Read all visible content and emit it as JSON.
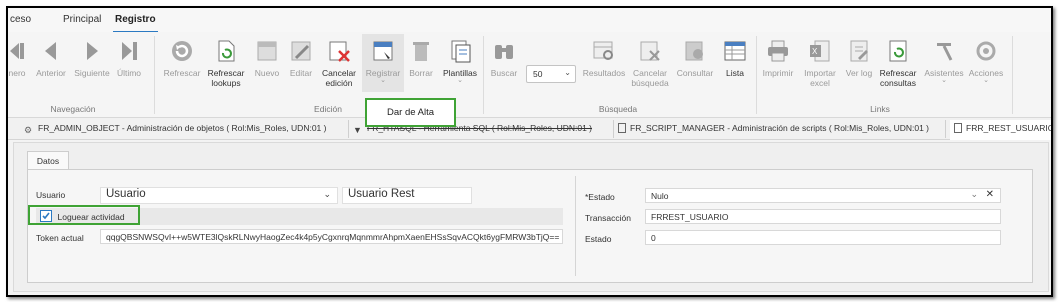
{
  "menu": {
    "tabs": [
      "ceso",
      "Principal",
      "Registro"
    ]
  },
  "ribbon": {
    "navegacion": {
      "items": [
        "nero",
        "Anterior",
        "Siguiente",
        "Último"
      ],
      "group_label": "Navegación"
    },
    "edicion": {
      "refrescar": "Refrescar",
      "refrescar_lookups_1": "Refrescar",
      "refrescar_lookups_2": "lookups",
      "nuevo": "Nuevo",
      "editar": "Editar",
      "cancelar_1": "Cancelar",
      "cancelar_2": "edición",
      "registrar": "Registrar",
      "borrar": "Borrar",
      "plantillas": "Plantillas",
      "group_label": "Edición"
    },
    "busqueda": {
      "buscar": "Buscar",
      "count_value": "50",
      "resultados": "Resultados",
      "cancelar_1": "Cancelar",
      "cancelar_2": "búsqueda",
      "consultar": "Consultar",
      "lista": "Lista",
      "group_label": "Búsqueda"
    },
    "links": {
      "imprimir": "Imprimir",
      "importar_1": "Importar",
      "importar_2": "excel",
      "ver_log": "Ver log",
      "refrescar_1": "Refrescar",
      "refrescar_2": "consultas",
      "asistentes": "Asistentes",
      "acciones": "Acciones",
      "group_label": "Links"
    }
  },
  "popup": {
    "label": "Dar de Alta"
  },
  "doc_tabs": [
    "FR_ADMIN_OBJECT - Administración de objetos ( Rol:Mis_Roles, UDN:01 )",
    "FR_HTASQL - Herramienta SQL ( Rol:Mis_Roles, UDN:01 )",
    "FR_SCRIPT_MANAGER - Administración de scripts ( Rol:Mis_Roles, UDN:01 )",
    "FRR_REST_USUARIO - ("
  ],
  "form": {
    "tab": "Datos",
    "usuario_label": "Usuario",
    "usuario_value": "Usuario",
    "usuario_name": "Usuario Rest",
    "loguear_label": "Loguear actividad",
    "token_label": "Token actual",
    "token_value": "qqgQBSNWSQvI++w5WTE3lQskRLNwyHaogZec4k4p5yCgxnrqMqnmmrAhpmXaenEHSsSqvACQkt6ygFMRW3bTjQ==",
    "estado_label": "*Estado",
    "estado_value": "Nulo",
    "transaccion_label": "Transacción",
    "transaccion_value": "FRREST_USUARIO",
    "estado2_label": "Estado",
    "estado2_value": "0"
  },
  "colors": {
    "accent": "#2b79c2",
    "highlight": "#3fa335"
  }
}
